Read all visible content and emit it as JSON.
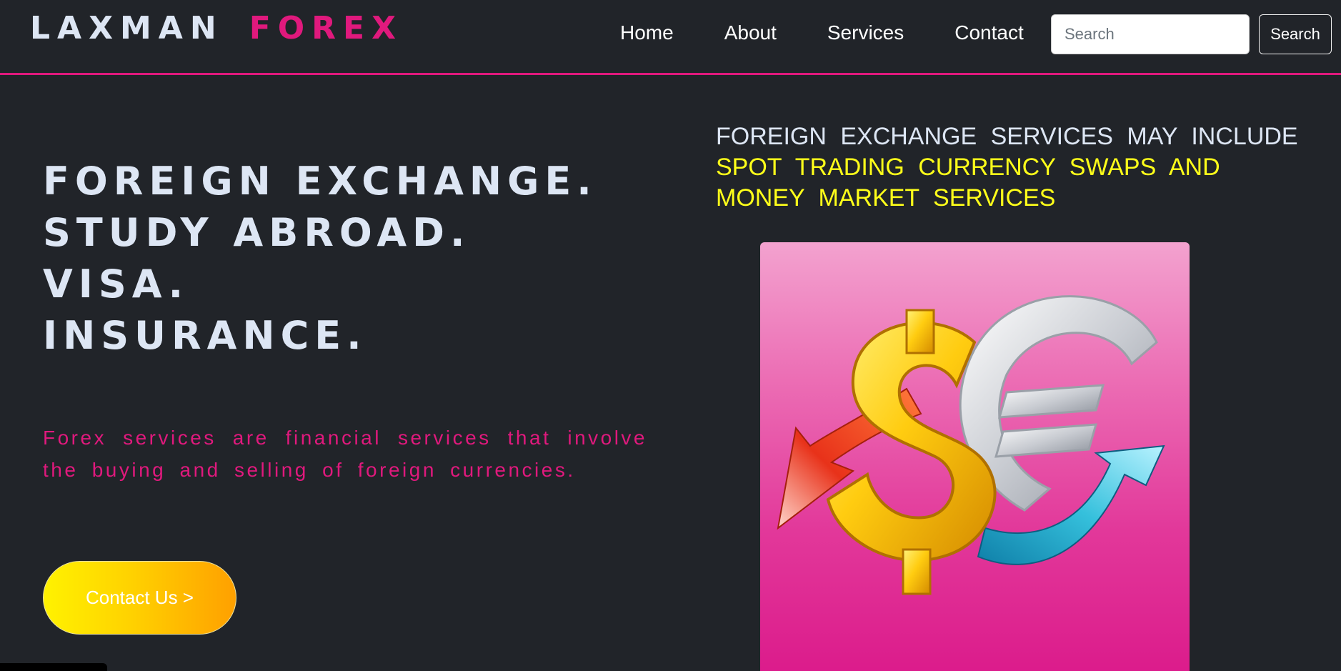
{
  "brand": {
    "part1": "LAXMAN",
    "part2": "FOREX"
  },
  "nav": {
    "links": [
      "Home",
      "About",
      "Services",
      "Contact"
    ],
    "search_placeholder": "Search",
    "search_button": "Search"
  },
  "hero": {
    "heading_lines": [
      "FOREIGN EXCHANGE.",
      "STUDY ABROAD.",
      "VISA.",
      "INSURANCE."
    ],
    "description": "Forex services are financial services that involve the buying and selling of foreign currencies.",
    "cta_label": "Contact Us >"
  },
  "services": {
    "intro": "FOREIGN EXCHANGE SERVICES MAY INCLUDE",
    "highlight": "SPOT TRADING CURRENCY SWAPS AND MONEY MARKET SERVICES"
  },
  "colors": {
    "background": "#212429",
    "accent_pink": "#e0197d",
    "highlight_yellow": "#ffff1a",
    "text_light": "#dde6f4"
  },
  "icons": {
    "hero_image": "dollar-euro-exchange-icon"
  }
}
